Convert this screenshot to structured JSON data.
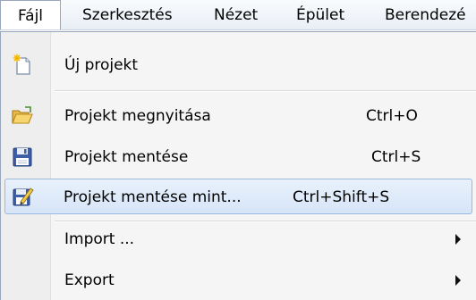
{
  "menubar": {
    "items": [
      {
        "label": "Fájl"
      },
      {
        "label": "Szerkesztés"
      },
      {
        "label": "Nézet"
      },
      {
        "label": "Épület"
      },
      {
        "label": "Berendezé"
      }
    ]
  },
  "menu": {
    "items": [
      {
        "label": "Új projekt",
        "shortcut": "",
        "icon": "new-project-icon"
      },
      {
        "label": "Projekt megnyitása",
        "shortcut": "Ctrl+O",
        "icon": "open-folder-icon"
      },
      {
        "label": "Projekt mentése",
        "shortcut": "Ctrl+S",
        "icon": "save-disk-icon"
      },
      {
        "label": "Projekt mentése mint...",
        "shortcut": "Ctrl+Shift+S",
        "icon": "save-as-icon",
        "highlighted": true
      },
      {
        "label": "Import ...",
        "shortcut": "",
        "submenu": true
      },
      {
        "label": "Export",
        "shortcut": "",
        "submenu": true
      }
    ]
  },
  "colors": {
    "highlight_fill": "#dce9fa",
    "highlight_border": "#9ab7dd",
    "menu_background": "#f5f5f5"
  }
}
